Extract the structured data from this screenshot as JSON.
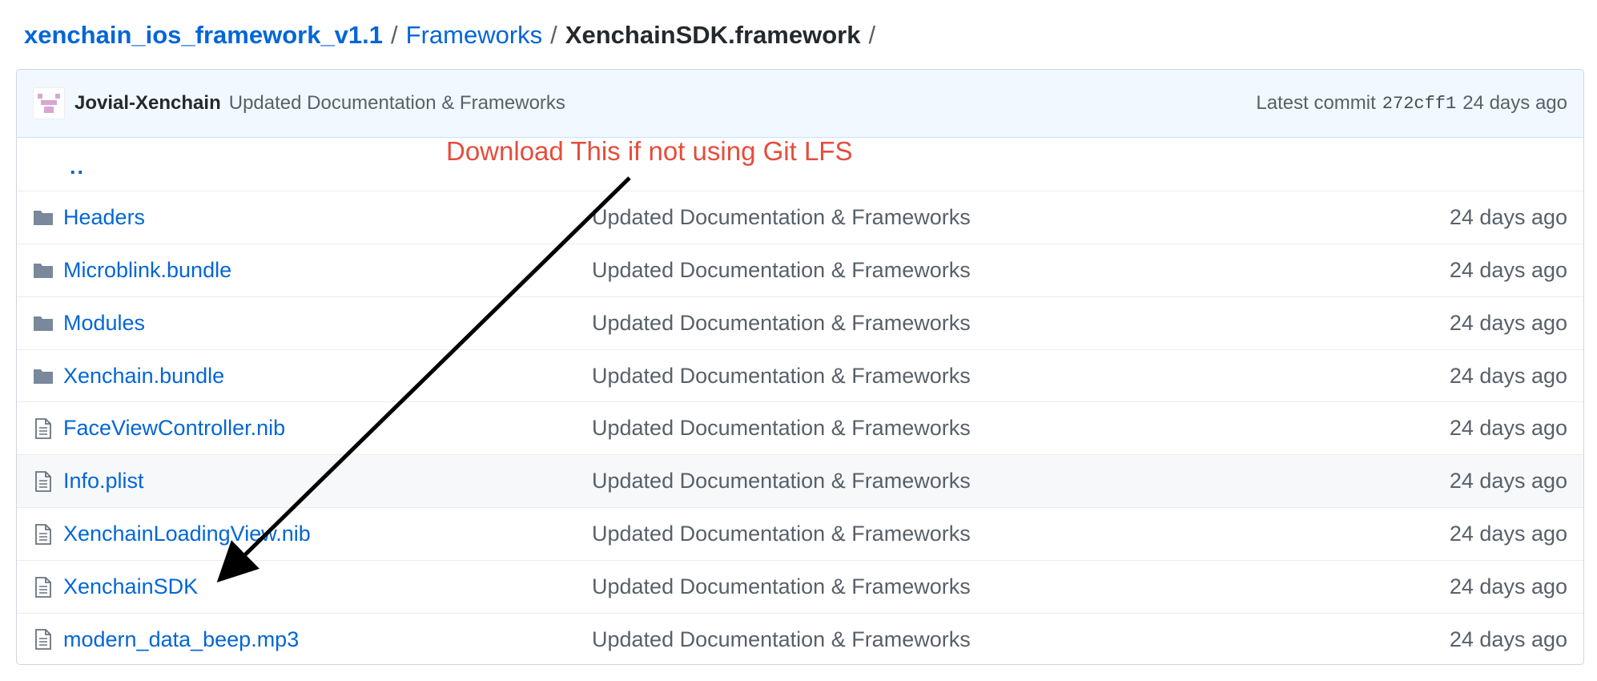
{
  "breadcrumb": {
    "root": "xenchain_ios_framework_v1.1",
    "items": [
      "Frameworks"
    ],
    "current": "XenchainSDK.framework",
    "separator": "/"
  },
  "commit": {
    "author": "Jovial-Xenchain",
    "message": "Updated Documentation & Frameworks",
    "latest_label": "Latest commit",
    "sha": "272cff1",
    "age": "24 days ago"
  },
  "parent_dir": "..",
  "files": [
    {
      "name": "Headers",
      "type": "folder",
      "message": "Updated Documentation & Frameworks",
      "age": "24 days ago"
    },
    {
      "name": "Microblink.bundle",
      "type": "folder",
      "message": "Updated Documentation & Frameworks",
      "age": "24 days ago"
    },
    {
      "name": "Modules",
      "type": "folder",
      "message": "Updated Documentation & Frameworks",
      "age": "24 days ago"
    },
    {
      "name": "Xenchain.bundle",
      "type": "folder",
      "message": "Updated Documentation & Frameworks",
      "age": "24 days ago"
    },
    {
      "name": "FaceViewController.nib",
      "type": "file",
      "message": "Updated Documentation & Frameworks",
      "age": "24 days ago"
    },
    {
      "name": "Info.plist",
      "type": "file",
      "message": "Updated Documentation & Frameworks",
      "age": "24 days ago"
    },
    {
      "name": "XenchainLoadingView.nib",
      "type": "file",
      "message": "Updated Documentation & Frameworks",
      "age": "24 days ago"
    },
    {
      "name": "XenchainSDK",
      "type": "file",
      "message": "Updated Documentation & Frameworks",
      "age": "24 days ago"
    },
    {
      "name": "modern_data_beep.mp3",
      "type": "file",
      "message": "Updated Documentation & Frameworks",
      "age": "24 days ago"
    }
  ],
  "annotation": {
    "text": "Download This if not using Git LFS",
    "color": "#e74c3c"
  },
  "colors": {
    "link": "#0366d6",
    "muted": "#586069",
    "folder_icon": "#79889b",
    "commit_bar_bg": "#f1f8ff"
  }
}
